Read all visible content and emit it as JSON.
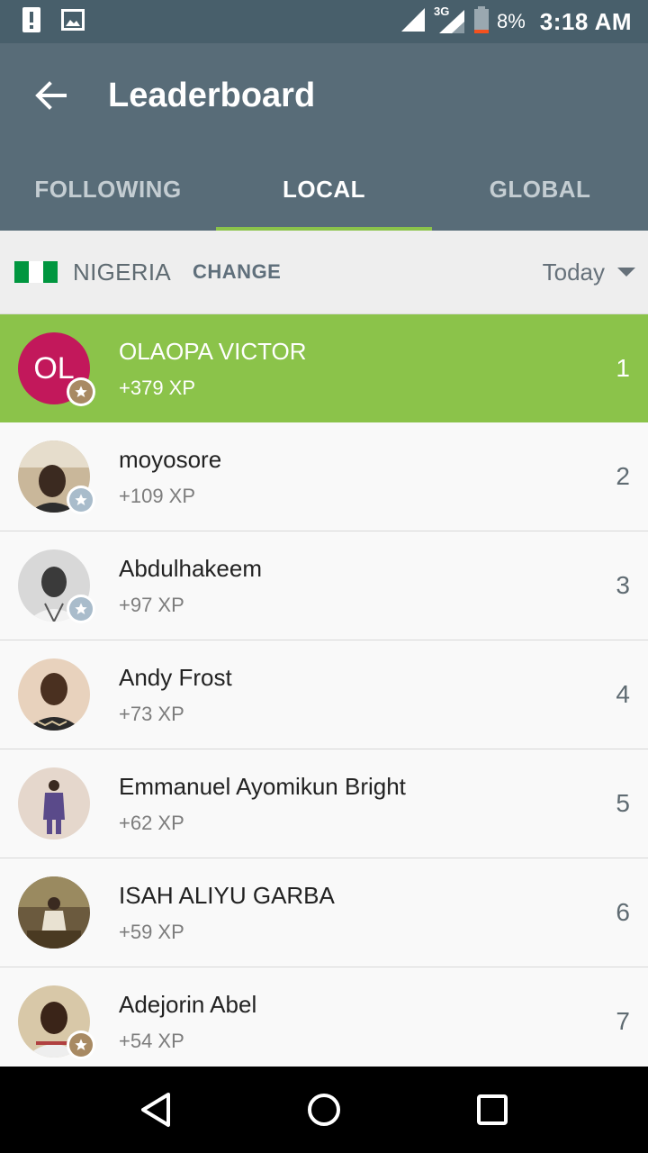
{
  "status_bar": {
    "battery_percent": "8%",
    "time": "3:18 AM",
    "network": "3G"
  },
  "app_bar": {
    "title": "Leaderboard"
  },
  "tabs": [
    {
      "label": "FOLLOWING",
      "active": false
    },
    {
      "label": "LOCAL",
      "active": true
    },
    {
      "label": "GLOBAL",
      "active": false
    }
  ],
  "filter": {
    "country": "NIGERIA",
    "change_label": "CHANGE",
    "period": "Today"
  },
  "leaderboard": [
    {
      "name": "OLAOPA VICTOR",
      "xp": "+379 XP",
      "rank": "1",
      "initials": "OL",
      "badge": "gold",
      "current_user": true
    },
    {
      "name": "moyosore",
      "xp": "+109 XP",
      "rank": "2",
      "badge": "silver"
    },
    {
      "name": "Abdulhakeem",
      "xp": "+97 XP",
      "rank": "3",
      "badge": "silver"
    },
    {
      "name": "Andy Frost",
      "xp": "+73 XP",
      "rank": "4"
    },
    {
      "name": "Emmanuel Ayomikun Bright",
      "xp": "+62 XP",
      "rank": "5"
    },
    {
      "name": "ISAH ALIYU GARBA",
      "xp": "+59 XP",
      "rank": "6"
    },
    {
      "name": "Adejorin Abel",
      "xp": "+54 XP",
      "rank": "7",
      "badge": "gold"
    }
  ],
  "colors": {
    "status_bar": "#485f6b",
    "app_bar": "#586c78",
    "accent": "#8bc34a",
    "avatar_initials_bg": "#c2185b"
  }
}
